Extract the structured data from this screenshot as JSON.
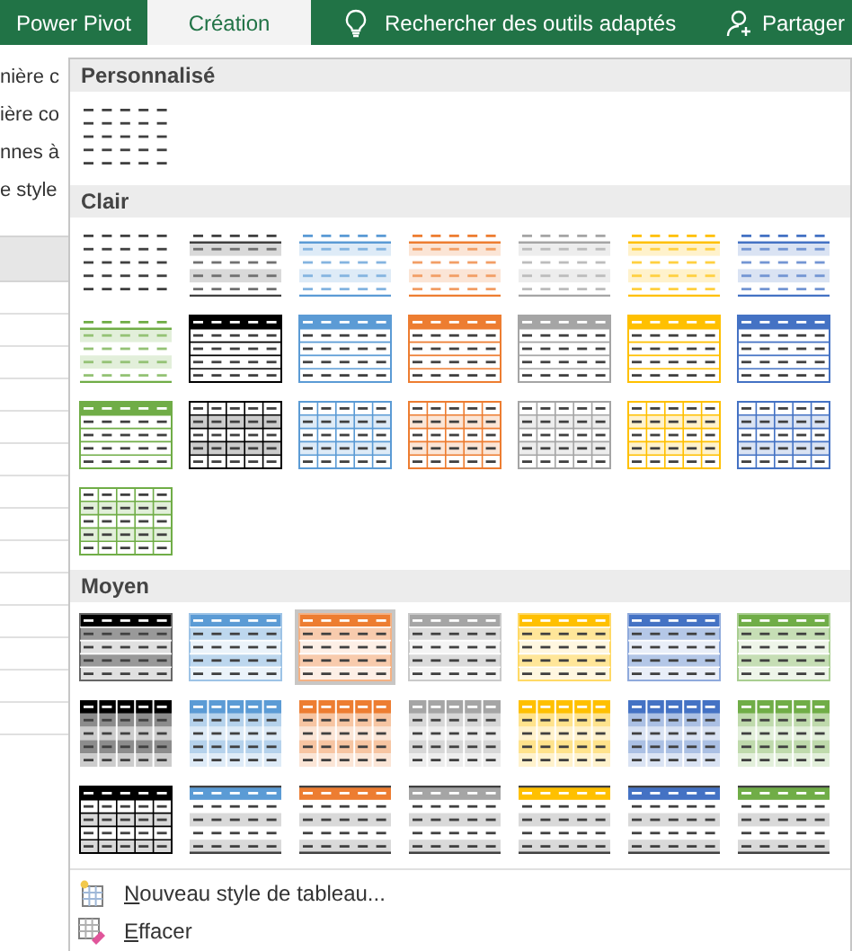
{
  "tabs": [
    {
      "label": "Power Pivot",
      "selected": false
    },
    {
      "label": "Création",
      "selected": true
    }
  ],
  "search": {
    "label": "Rechercher des outils adaptés"
  },
  "share": {
    "label": "Partager"
  },
  "sheet_fragments": [
    "nière c",
    "ière co",
    "nnes à",
    "e style"
  ],
  "sections": [
    {
      "title": "Personnalisé",
      "tiles": [
        {
          "kind": "plain",
          "color": "#404040",
          "selected": false
        }
      ]
    },
    {
      "title": "Clair",
      "tiles": [
        {
          "kind": "plain",
          "color": "#404040",
          "selected": false
        },
        {
          "kind": "light-stripes",
          "color": "#404040",
          "selected": false
        },
        {
          "kind": "light-stripes",
          "color": "#5b9bd5",
          "selected": false
        },
        {
          "kind": "light-stripes",
          "color": "#ed7d31",
          "selected": false
        },
        {
          "kind": "light-stripes",
          "color": "#a5a5a5",
          "selected": false
        },
        {
          "kind": "light-stripes",
          "color": "#ffc000",
          "selected": false
        },
        {
          "kind": "light-stripes",
          "color": "#4472c4",
          "selected": false
        },
        {
          "kind": "light-stripes",
          "color": "#70ad47",
          "selected": false
        },
        {
          "kind": "header-box",
          "color": "#000000",
          "selected": false
        },
        {
          "kind": "header-box",
          "color": "#5b9bd5",
          "selected": false
        },
        {
          "kind": "header-box",
          "color": "#ed7d31",
          "selected": false
        },
        {
          "kind": "header-box",
          "color": "#a5a5a5",
          "selected": false
        },
        {
          "kind": "header-box",
          "color": "#ffc000",
          "selected": false
        },
        {
          "kind": "header-box",
          "color": "#4472c4",
          "selected": false
        },
        {
          "kind": "header-box",
          "color": "#70ad47",
          "selected": false
        },
        {
          "kind": "grid",
          "color": "#000000",
          "selected": false
        },
        {
          "kind": "grid",
          "color": "#5b9bd5",
          "selected": false
        },
        {
          "kind": "grid",
          "color": "#ed7d31",
          "selected": false
        },
        {
          "kind": "grid",
          "color": "#a5a5a5",
          "selected": false
        },
        {
          "kind": "grid",
          "color": "#ffc000",
          "selected": false
        },
        {
          "kind": "grid",
          "color": "#4472c4",
          "selected": false
        },
        {
          "kind": "grid",
          "color": "#70ad47",
          "selected": false
        }
      ]
    },
    {
      "title": "Moyen",
      "tiles": [
        {
          "kind": "medium-banded",
          "color": "#000000",
          "selected": false
        },
        {
          "kind": "medium-banded",
          "color": "#5b9bd5",
          "selected": false
        },
        {
          "kind": "medium-banded",
          "color": "#ed7d31",
          "selected": true
        },
        {
          "kind": "medium-banded",
          "color": "#a5a5a5",
          "selected": false
        },
        {
          "kind": "medium-banded",
          "color": "#ffc000",
          "selected": false
        },
        {
          "kind": "medium-banded",
          "color": "#4472c4",
          "selected": false
        },
        {
          "kind": "medium-banded",
          "color": "#70ad47",
          "selected": false
        },
        {
          "kind": "medium-columns",
          "color": "#000000",
          "selected": false
        },
        {
          "kind": "medium-columns",
          "color": "#5b9bd5",
          "selected": false
        },
        {
          "kind": "medium-columns",
          "color": "#ed7d31",
          "selected": false
        },
        {
          "kind": "medium-columns",
          "color": "#a5a5a5",
          "selected": false
        },
        {
          "kind": "medium-columns",
          "color": "#ffc000",
          "selected": false
        },
        {
          "kind": "medium-columns",
          "color": "#4472c4",
          "selected": false
        },
        {
          "kind": "medium-columns",
          "color": "#70ad47",
          "selected": false
        },
        {
          "kind": "header-grid",
          "color": "#000000",
          "selected": false
        },
        {
          "kind": "medium-lines",
          "color": "#5b9bd5",
          "selected": false
        },
        {
          "kind": "medium-lines",
          "color": "#ed7d31",
          "selected": false
        },
        {
          "kind": "medium-lines",
          "color": "#a5a5a5",
          "selected": false
        },
        {
          "kind": "medium-lines",
          "color": "#ffc000",
          "selected": false
        },
        {
          "kind": "medium-lines",
          "color": "#4472c4",
          "selected": false
        },
        {
          "kind": "medium-lines",
          "color": "#70ad47",
          "selected": false
        }
      ]
    }
  ],
  "menu": [
    {
      "kind": "new",
      "label": "Nouveau style de tableau..."
    },
    {
      "kind": "clear",
      "label": "Effacer"
    }
  ]
}
